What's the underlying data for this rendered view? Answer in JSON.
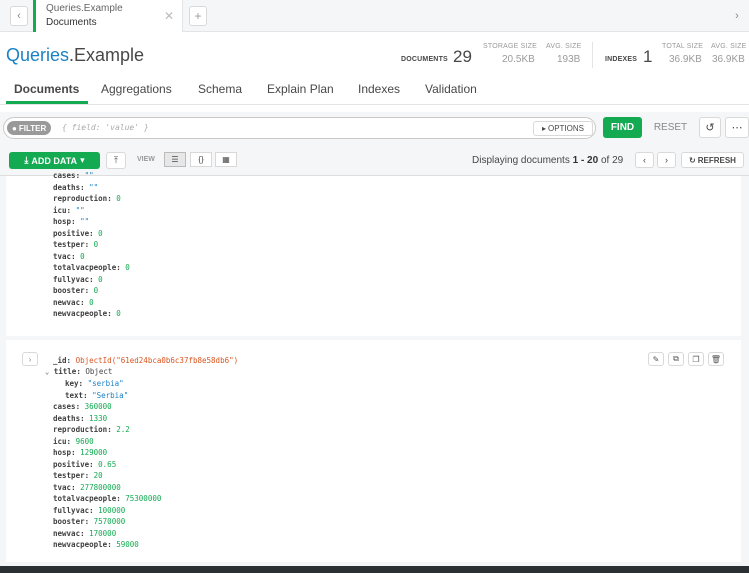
{
  "tabstrip": {
    "tab_db_coll": "Queries.Example",
    "tab_subtitle": "Documents",
    "close_glyph": "✕",
    "new_tab_glyph": "+",
    "back_glyph": "‹",
    "forward_glyph": "›"
  },
  "header": {
    "db": "Queries",
    "coll": ".Example",
    "documents_label": "DOCUMENTS",
    "documents_count": "29",
    "storage_size_label": "STORAGE SIZE",
    "storage_size": "20.5KB",
    "avg_size_label": "AVG. SIZE",
    "avg_size": "193B",
    "indexes_label": "INDEXES",
    "indexes_count": "1",
    "total_size_label": "TOTAL SIZE",
    "total_size": "36.9KB",
    "avg_size2_label": "AVG. SIZE",
    "avg_size2": "36.9KB"
  },
  "subtabs": [
    "Documents",
    "Aggregations",
    "Schema",
    "Explain Plan",
    "Indexes",
    "Validation"
  ],
  "filter": {
    "pill_label": "FILTER",
    "placeholder": "{ field: 'value' }",
    "options_label": "OPTIONS",
    "find_label": "FIND",
    "reset_label": "RESET"
  },
  "toolbar": {
    "add_data_label": "ADD DATA",
    "view_label": "VIEW",
    "pager_prefix": "Displaying documents ",
    "pager_range": "1 - 20",
    "pager_suffix": " of 29",
    "refresh_label": "REFRESH"
  },
  "doc1": [
    {
      "k": "cases",
      "v": "\"\"",
      "t": "str"
    },
    {
      "k": "deaths",
      "v": "\"\"",
      "t": "str"
    },
    {
      "k": "reproduction",
      "v": "0",
      "t": "num"
    },
    {
      "k": "icu",
      "v": "\"\"",
      "t": "str"
    },
    {
      "k": "hosp",
      "v": "\"\"",
      "t": "str"
    },
    {
      "k": "positive",
      "v": "0",
      "t": "num"
    },
    {
      "k": "testper",
      "v": "0",
      "t": "num"
    },
    {
      "k": "tvac",
      "v": "0",
      "t": "num"
    },
    {
      "k": "totalvacpeople",
      "v": "0",
      "t": "num"
    },
    {
      "k": "fullyvac",
      "v": "0",
      "t": "num"
    },
    {
      "k": "booster",
      "v": "0",
      "t": "num"
    },
    {
      "k": "newvac",
      "v": "0",
      "t": "num"
    },
    {
      "k": "newvacpeople",
      "v": "0",
      "t": "num"
    }
  ],
  "doc2": {
    "id_key": "_id",
    "id_value": "ObjectId(\"61ed24bca0b6c37fb8e58db6\")",
    "title_key": "title",
    "title_value": "Object",
    "title_fields": [
      {
        "k": "key",
        "v": "\"serbia\"",
        "t": "str"
      },
      {
        "k": "text",
        "v": "\"Serbia\"",
        "t": "str"
      }
    ],
    "fields": [
      {
        "k": "cases",
        "v": "360000",
        "t": "num"
      },
      {
        "k": "deaths",
        "v": "1330",
        "t": "num"
      },
      {
        "k": "reproduction",
        "v": "2.2",
        "t": "num"
      },
      {
        "k": "icu",
        "v": "9600",
        "t": "num"
      },
      {
        "k": "hosp",
        "v": "129000",
        "t": "num"
      },
      {
        "k": "positive",
        "v": "0.65",
        "t": "num"
      },
      {
        "k": "testper",
        "v": "20",
        "t": "num"
      },
      {
        "k": "tvac",
        "v": "277800000",
        "t": "num"
      },
      {
        "k": "totalvacpeople",
        "v": "75300000",
        "t": "num"
      },
      {
        "k": "fullyvac",
        "v": "100000",
        "t": "num"
      },
      {
        "k": "booster",
        "v": "7570000",
        "t": "num"
      },
      {
        "k": "newvac",
        "v": "170000",
        "t": "num"
      },
      {
        "k": "newvacpeople",
        "v": "59000",
        "t": "num"
      }
    ]
  },
  "colors": {
    "accent_green": "#13aa52",
    "db_blue": "#1a82c4",
    "oid_orange": "#d9541e"
  }
}
